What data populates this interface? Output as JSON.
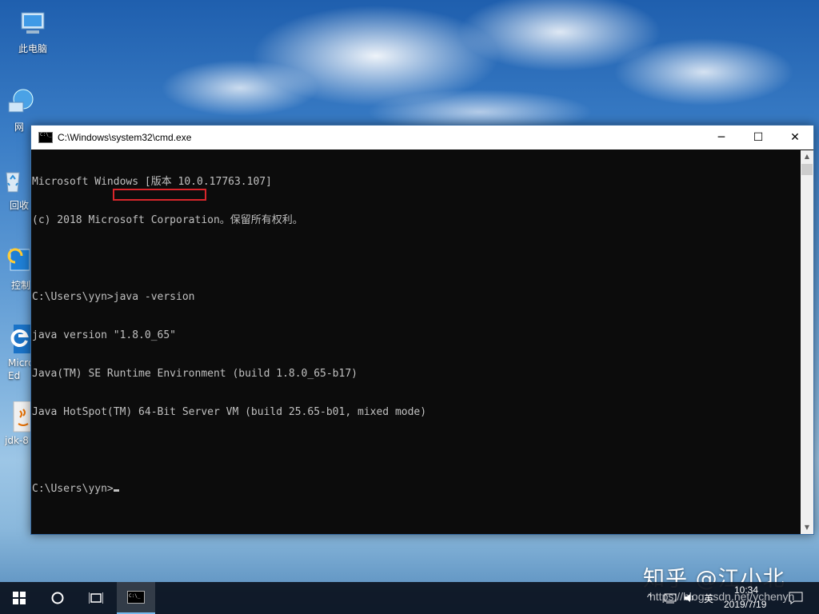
{
  "desktop": {
    "icons": [
      {
        "label": "此电脑",
        "icon": "computer-icon"
      },
      {
        "label": "网",
        "icon": "network-icon"
      },
      {
        "label": "回收",
        "icon": "recycle-bin-icon"
      },
      {
        "label": "控制",
        "icon": "control-panel-icon"
      },
      {
        "label": "Micro Ed",
        "icon": "edge-icon"
      },
      {
        "label": "jdk-8",
        "icon": "java-installer-icon"
      }
    ]
  },
  "cmd": {
    "title": "C:\\Windows\\system32\\cmd.exe",
    "lines": [
      "Microsoft Windows [版本 10.0.17763.107]",
      "(c) 2018 Microsoft Corporation。保留所有权利。",
      "",
      "C:\\Users\\yyn>java -version",
      "java version \"1.8.0_65\"",
      "Java(TM) SE Runtime Environment (build 1.8.0_65-b17)",
      "Java HotSpot(TM) 64-Bit Server VM (build 25.65-b01, mixed mode)",
      "",
      "C:\\Users\\yyn>"
    ],
    "controls": {
      "minimize": "─",
      "maximize": "☐",
      "close": "✕"
    }
  },
  "taskbar": {
    "start_icon": "windows-start-icon",
    "search_icon": "cortana-search-icon",
    "taskview_icon": "task-view-icon",
    "app_icon": "cmd-taskbar-icon",
    "tray": {
      "chevron": "^",
      "ime": "英",
      "time": "10:34",
      "date": "2019/7/19"
    }
  },
  "watermark": {
    "text": "知乎 @江小北",
    "url": "https://blog.csdn.net/ychenyn"
  }
}
